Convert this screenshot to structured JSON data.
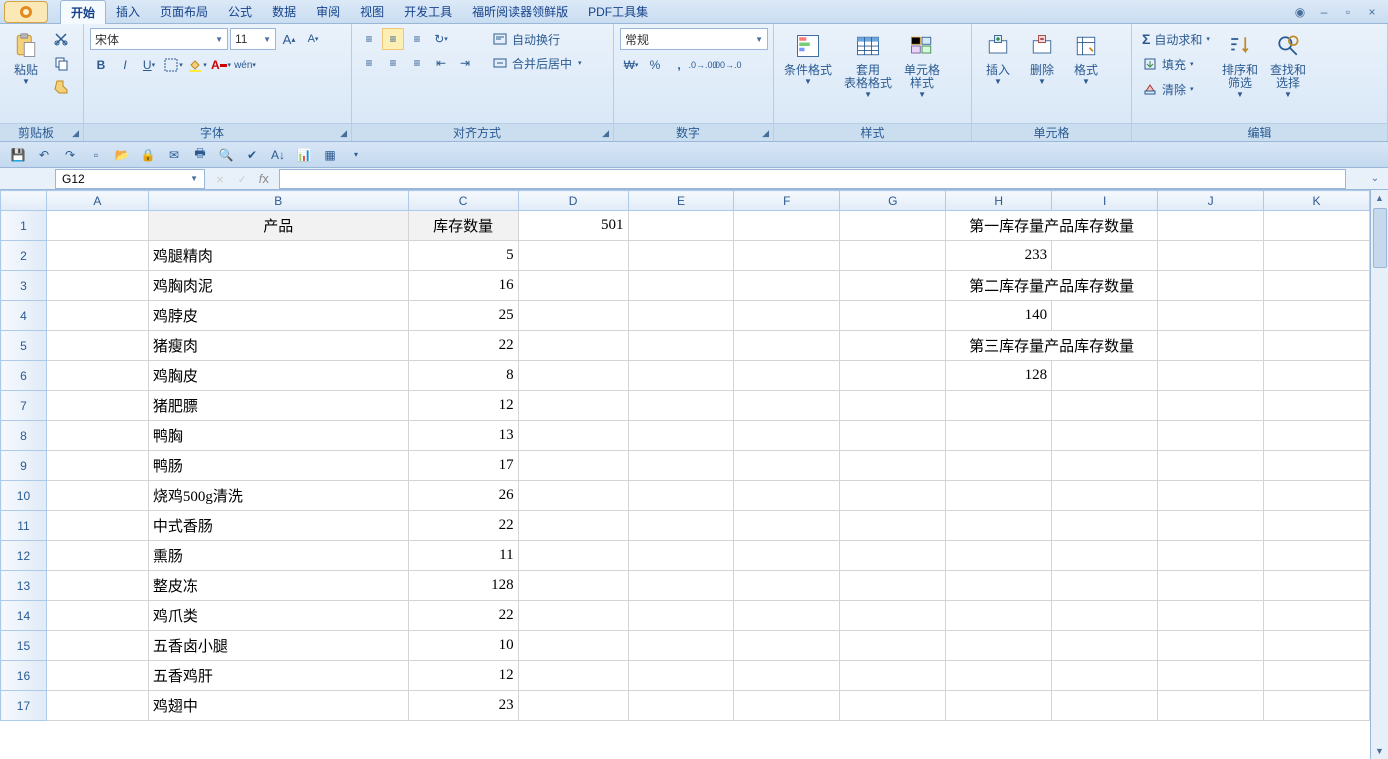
{
  "tabs": [
    "开始",
    "插入",
    "页面布局",
    "公式",
    "数据",
    "审阅",
    "视图",
    "开发工具",
    "福昕阅读器领鲜版",
    "PDF工具集"
  ],
  "activeTab": 0,
  "ribbon": {
    "clipboard": {
      "title": "剪贴板",
      "paste": "粘贴"
    },
    "font": {
      "title": "字体",
      "name": "宋体",
      "size": "11"
    },
    "align": {
      "title": "对齐方式",
      "wrap": "自动换行",
      "merge": "合并后居中"
    },
    "number": {
      "title": "数字",
      "format": "常规"
    },
    "styles": {
      "title": "样式",
      "cond": "条件格式",
      "table": "套用\n表格格式",
      "cell": "单元格\n样式"
    },
    "cells": {
      "title": "单元格",
      "insert": "插入",
      "delete": "删除",
      "format": "格式"
    },
    "edit": {
      "title": "编辑",
      "sum": "自动求和",
      "fill": "填充",
      "clear": "清除",
      "sort": "排序和\n筛选",
      "find": "查找和\n选择"
    }
  },
  "namebox": "G12",
  "columns": [
    "A",
    "B",
    "C",
    "D",
    "E",
    "F",
    "G",
    "H",
    "I",
    "J",
    "K"
  ],
  "cells": {
    "B1": "产品",
    "C1": "库存数量",
    "D1": "501",
    "H1I1": "第一库存量产品库存数量",
    "B2": "鸡腿精肉",
    "C2": "5",
    "H2": "233",
    "B3": "鸡胸肉泥",
    "C3": "16",
    "H3I3": "第二库存量产品库存数量",
    "B4": "鸡脖皮",
    "C4": "25",
    "H4": "140",
    "B5": "猪瘦肉",
    "C5": "22",
    "H5I5": "第三库存量产品库存数量",
    "B6": "鸡胸皮",
    "C6": "8",
    "H6": "128",
    "B7": "猪肥膘",
    "C7": "12",
    "B8": "鸭胸",
    "C8": "13",
    "B9": "鸭肠",
    "C9": "17",
    "B10": "烧鸡500g清洗",
    "C10": "26",
    "B11": "中式香肠",
    "C11": "22",
    "B12": "熏肠",
    "C12": "11",
    "B13": "整皮冻",
    "C13": "128",
    "B14": "鸡爪类",
    "C14": "22",
    "B15": "五香卤小腿",
    "C15": "10",
    "B16": "五香鸡肝",
    "C16": "12",
    "B17": "鸡翅中",
    "C17": "23"
  }
}
